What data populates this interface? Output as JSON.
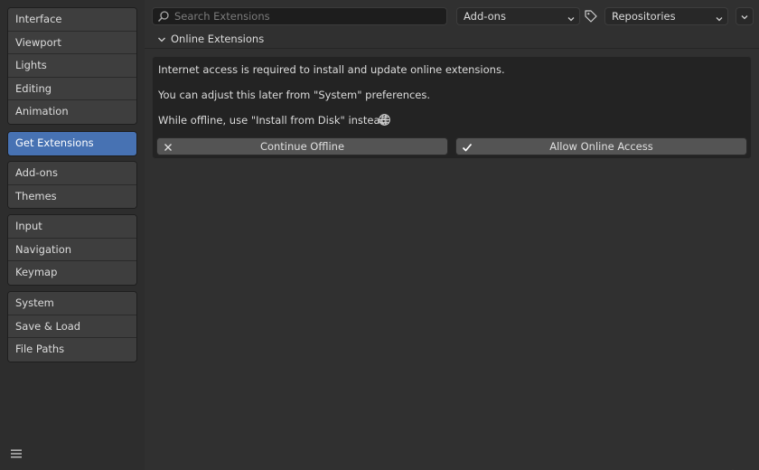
{
  "sidebar": {
    "groups": [
      {
        "items": [
          "Interface",
          "Viewport",
          "Lights",
          "Editing",
          "Animation"
        ]
      },
      {
        "items": [
          "Get Extensions"
        ]
      },
      {
        "items": [
          "Add-ons",
          "Themes"
        ]
      },
      {
        "items": [
          "Input",
          "Navigation",
          "Keymap"
        ]
      },
      {
        "items": [
          "System",
          "Save & Load",
          "File Paths"
        ]
      }
    ],
    "active": "Get Extensions"
  },
  "topbar": {
    "search_placeholder": "Search Extensions",
    "type_filter": "Add-ons",
    "repository_filter": "Repositories"
  },
  "section": {
    "title": "Online Extensions",
    "lines": [
      "Internet access is required to install and update online extensions.",
      "You can adjust this later from \"System\" preferences.",
      "While offline, use \"Install from Disk\" instead."
    ],
    "continue_offline_label": "Continue Offline",
    "allow_online_label": "Allow Online Access"
  },
  "colors": {
    "accent": "#4772b3",
    "background": "#303030",
    "panel": "#232323",
    "button": "#545454"
  },
  "icons": [
    "search-icon",
    "chevron-down-icon",
    "tag-icon",
    "globe-icon",
    "close-icon",
    "checkmark-icon",
    "menu-icon"
  ]
}
